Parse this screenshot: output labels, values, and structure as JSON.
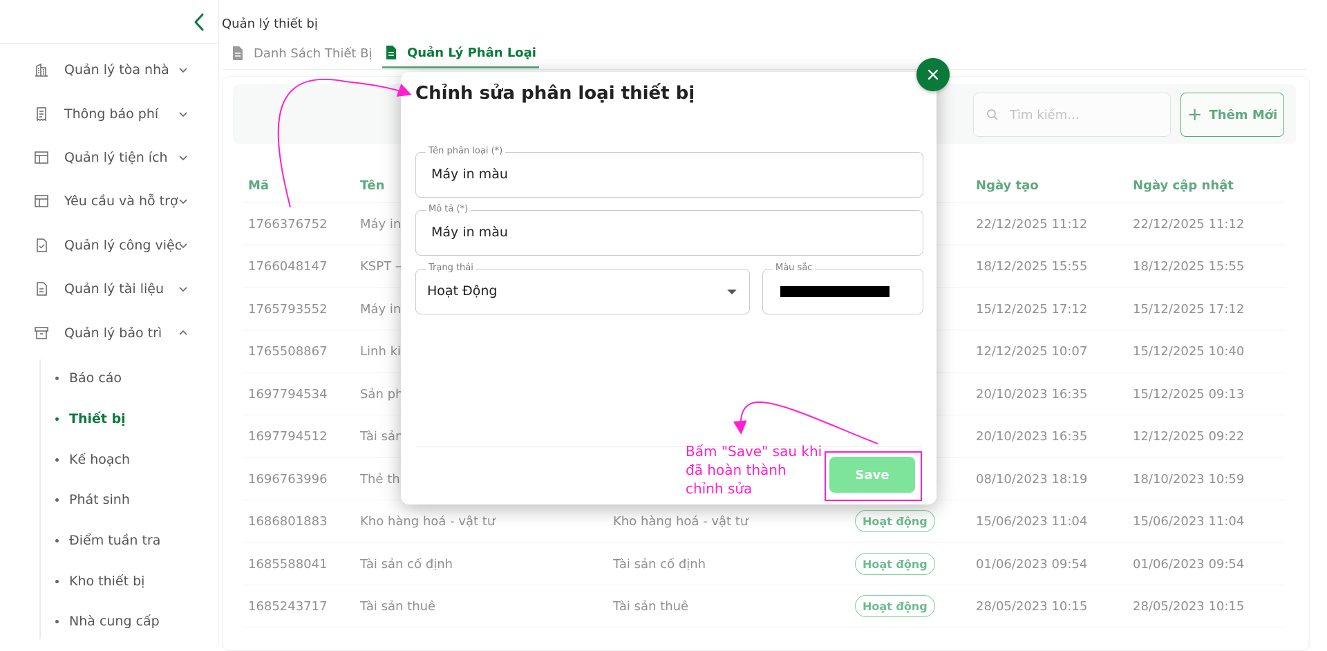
{
  "sidebar": {
    "menu": [
      {
        "label": "Quản lý tòa nhà",
        "icon": "building-icon"
      },
      {
        "label": "Thông báo phí",
        "icon": "receipt-icon"
      },
      {
        "label": "Quản lý tiện ích",
        "icon": "layout-icon"
      },
      {
        "label": "Yêu cầu và hỗ trợ",
        "icon": "layout-icon"
      },
      {
        "label": "Quản lý công việc",
        "icon": "task-icon"
      },
      {
        "label": "Quản lý tài liệu",
        "icon": "document-icon"
      },
      {
        "label": "Quản lý bảo trì",
        "icon": "archive-icon"
      }
    ],
    "submenu": [
      "Báo cáo",
      "Thiết bị",
      "Kế hoạch",
      "Phát sinh",
      "Điểm tuần tra",
      "Kho thiết bị",
      "Nhà cung cấp"
    ],
    "active_submenu": "Thiết bị"
  },
  "header": {
    "breadcrumb": "Quản lý thiết bị",
    "tabs": [
      {
        "label": "Danh Sách Thiết Bị",
        "active": false
      },
      {
        "label": "Quản Lý Phân Loại",
        "active": true
      }
    ]
  },
  "toolbar": {
    "search_placeholder": "Tìm kiếm...",
    "add_label": "Thêm Mới"
  },
  "table": {
    "columns": [
      "Mã",
      "Tên",
      "Ngày tạo",
      "Ngày cập nhật"
    ],
    "rows": [
      {
        "code": "1766376752",
        "name": "Máy in",
        "desc": "",
        "status": "",
        "created": "22/12/2025 11:12",
        "updated": "22/12/2025 11:12"
      },
      {
        "code": "1766048147",
        "name": "KSPT –",
        "desc": "",
        "status": "",
        "created": "18/12/2025 15:55",
        "updated": "18/12/2025 15:55"
      },
      {
        "code": "1765793552",
        "name": "Máy in",
        "desc": "",
        "status": "",
        "created": "15/12/2025 17:12",
        "updated": "15/12/2025 17:12"
      },
      {
        "code": "1765508867",
        "name": "Linh kiệ",
        "desc": "",
        "status": "",
        "created": "12/12/2025 10:07",
        "updated": "15/12/2025 10:40"
      },
      {
        "code": "1697794534",
        "name": "Sản ph",
        "desc": "",
        "status": "",
        "created": "20/10/2023 16:35",
        "updated": "15/12/2025 09:13"
      },
      {
        "code": "1697794512",
        "name": "Tài sản",
        "desc": "",
        "status": "",
        "created": "20/10/2023 16:35",
        "updated": "12/12/2025 09:22"
      },
      {
        "code": "1696763996",
        "name": "Thẻ thu",
        "desc": "",
        "status": "",
        "created": "08/10/2023 18:19",
        "updated": "18/10/2023 10:59"
      },
      {
        "code": "1686801883",
        "name": "Kho hàng hoá - vật tư",
        "desc": "Kho hàng hoá - vật tư",
        "status": "Hoạt động",
        "created": "15/06/2023 11:04",
        "updated": "15/06/2023 11:04"
      },
      {
        "code": "1685588041",
        "name": "Tài sản cố định",
        "desc": "Tài sản cố định",
        "status": "Hoạt động",
        "created": "01/06/2023 09:54",
        "updated": "01/06/2023 09:54"
      },
      {
        "code": "1685243717",
        "name": "Tài sản thuê",
        "desc": "Tài sản thuê",
        "status": "Hoạt động",
        "created": "28/05/2023 10:15",
        "updated": "28/05/2023 10:15"
      }
    ]
  },
  "modal": {
    "title": "Chỉnh sửa phân loại thiết bị",
    "name_label": "Tên phân loại (*)",
    "name_value": "Máy in màu",
    "desc_label": "Mô tả (*)",
    "desc_value": "Máy in màu",
    "status_label": "Trạng thái",
    "status_value": "Hoạt Động",
    "color_label": "Màu sắc",
    "color_value": "#000000",
    "save_label": "Save"
  },
  "annotation": {
    "text": "Bấm \"Save\" sau khi đã hoàn thành chỉnh sửa",
    "color": "#ff1fd0"
  },
  "colors": {
    "brand": "#0a7a3b",
    "save_button": "#7ee39b",
    "badge": "#1e9a53"
  }
}
